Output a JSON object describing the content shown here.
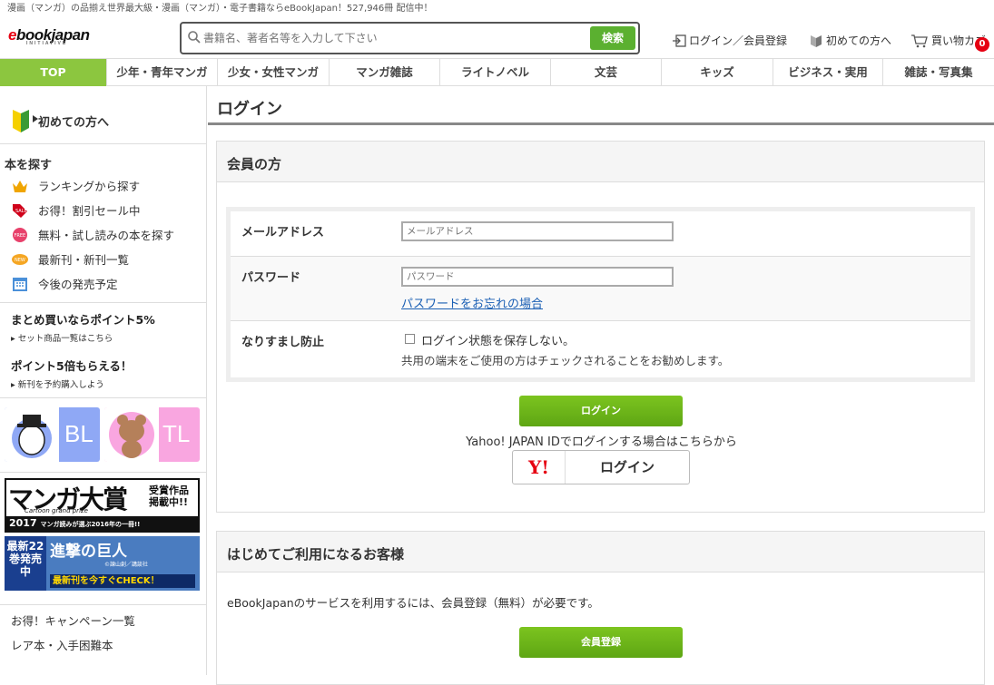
{
  "top_bar": {
    "text": "漫画（マンガ）の品揃え世界最大級・漫画（マンガ）・電子書籍ならeBookJapan！527,946冊 配信中！"
  },
  "header": {
    "logo_prefix": "e",
    "logo_rest": "bookjapan",
    "logo_sub": "INITIATIVE",
    "search_placeholder": "書籍名、著者名等を入力して下さい",
    "search_button": "検索",
    "login_link": "ログイン／会員登録",
    "first_time_link": "初めての方へ",
    "cart_link": "買い物カゴ",
    "cart_count": "0"
  },
  "nav": {
    "items": [
      "TOP",
      "少年・青年マンガ",
      "少女・女性マンガ",
      "マンガ雑誌",
      "ライトノベル",
      "文芸",
      "キッズ",
      "ビジネス・実用",
      "雑誌・写真集"
    ]
  },
  "sidebar": {
    "first_time": "初めての方へ",
    "find_title": "本を探す",
    "items": [
      {
        "label": "ランキングから探す",
        "icon": "crown-icon"
      },
      {
        "label": "お得！割引セール中",
        "icon": "sale-tag-icon"
      },
      {
        "label": "無料・試し読みの本を探す",
        "icon": "free-badge-icon"
      },
      {
        "label": "最新刊・新刊一覧",
        "icon": "new-badge-icon"
      },
      {
        "label": "今後の発売予定",
        "icon": "calendar-icon"
      }
    ],
    "promo1_title": "まとめ買いならポイント5%",
    "promo1_link": "セット商品一覧はこちら",
    "promo2_title": "ポイント5倍もらえる！",
    "promo2_link": "新刊を予約購入しよう",
    "bl_label": "BL",
    "tl_label": "TL",
    "manga_award_title": "マンガ大賞",
    "manga_award_year": "2017",
    "manga_award_sub": "Cartoon grand prize",
    "manga_award_side": "受賞作品掲載中!!",
    "manga_award_tagline": "マンガ読みが選ぶ2016年の一冊!!",
    "aot_left": "最新22巻発売中",
    "aot_title": "進撃の巨人",
    "aot_cta": "最新刊を今すぐCHECK！",
    "aot_credit": "©諫山創／講談社",
    "links": [
      "お得！キャンペーン一覧",
      "レア本・入手困難本"
    ]
  },
  "main": {
    "page_title": "ログイン",
    "member_header": "会員の方",
    "email_label": "メールアドレス",
    "email_placeholder": "メールアドレス",
    "password_label": "パスワード",
    "password_placeholder": "パスワード",
    "forgot_link": "パスワードをお忘れの場合",
    "spoof_label": "なりすまし防止",
    "keep_login_text": "ログイン状態を保存しない。",
    "shared_note": "共用の端末をご使用の方はチェックされることをお勧めします。",
    "login_button": "ログイン",
    "yahoo_note": "Yahoo! JAPAN IDでログインする場合はこちらから",
    "yahoo_logo": "Y!",
    "yahoo_button": "ログイン",
    "newcomer_header": "はじめてご利用になるお客様",
    "newcomer_text": "eBookJapanのサービスを利用するには、会員登録（無料）が必要です。",
    "register_button": "会員登録"
  },
  "colors": {
    "accent_green": "#8cc63f",
    "button_green": "#5ea614",
    "brand_red": "#e60012"
  }
}
